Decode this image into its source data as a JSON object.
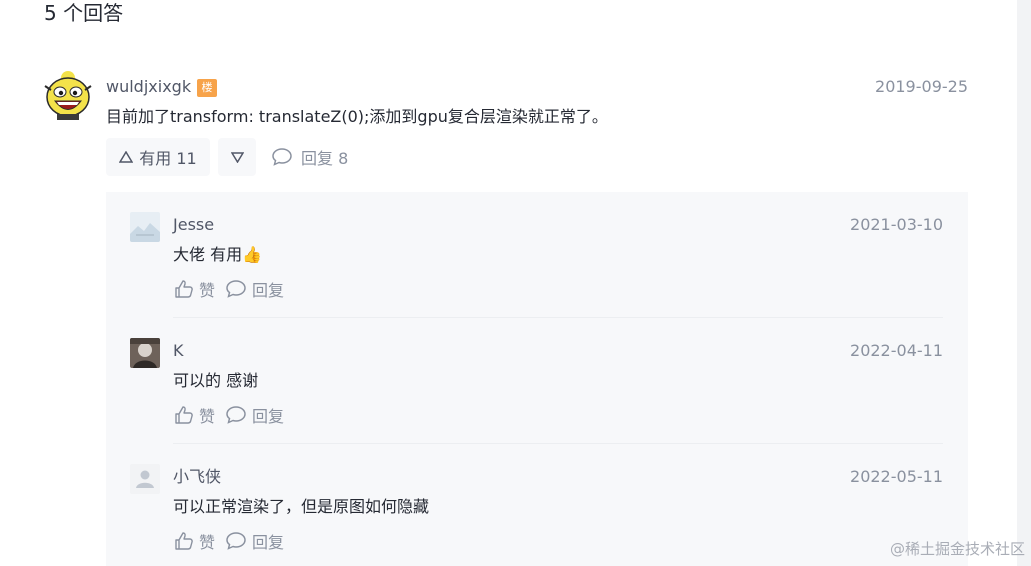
{
  "answers_count": "5 个回答",
  "answer": {
    "username": "wuldjxixgk",
    "badge": "楼",
    "date": "2019-09-25",
    "content": "目前加了transform: translateZ(0);添加到gpu复合层渲染就正常了。",
    "like_label": "有用 11",
    "reply_label": "回复 8",
    "badge_color": "#f7a34a"
  },
  "replies": [
    {
      "username": "Jesse",
      "date": "2021-03-10",
      "content": "大佬 有用",
      "emoji": "👍",
      "like_label": "赞",
      "reply_label": "回复"
    },
    {
      "username": "K",
      "date": "2022-04-11",
      "content": "可以的 感谢",
      "like_label": "赞",
      "reply_label": "回复"
    },
    {
      "username": "小飞侠",
      "date": "2022-05-11",
      "content": "可以正常渲染了，但是原图如何隐藏",
      "like_label": "赞",
      "reply_label": "回复"
    }
  ],
  "watermark": "@稀土掘金技术社区"
}
